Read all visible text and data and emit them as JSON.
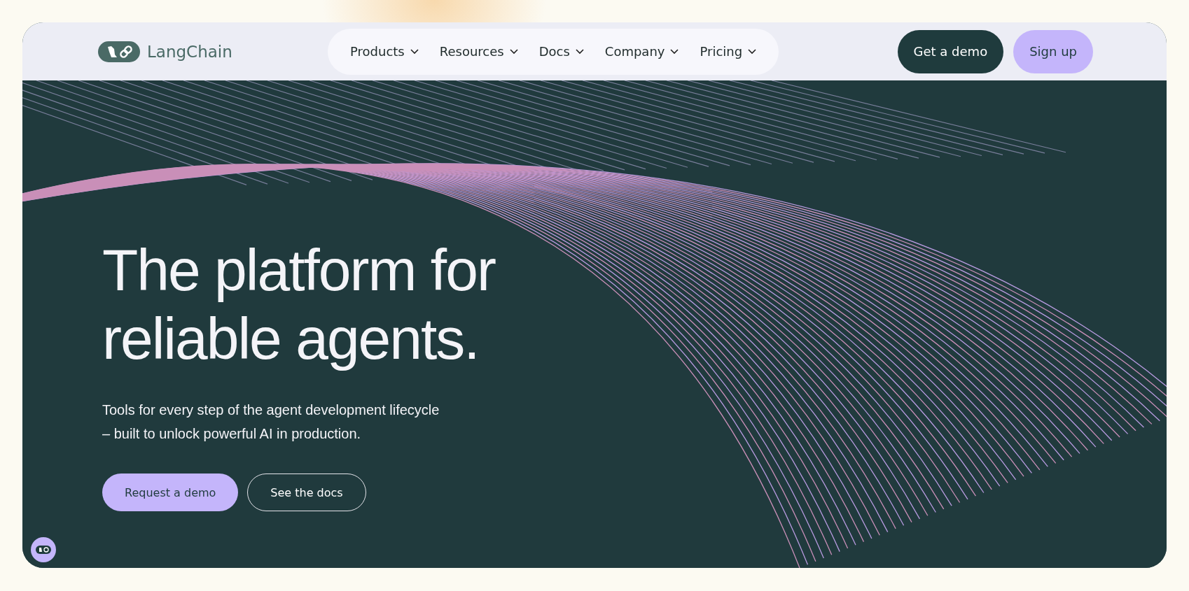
{
  "brand": {
    "name": "LangChain"
  },
  "nav": [
    {
      "label": "Products"
    },
    {
      "label": "Resources"
    },
    {
      "label": "Docs"
    },
    {
      "label": "Company"
    },
    {
      "label": "Pricing"
    }
  ],
  "header_buttons": [
    {
      "label": "Get a demo",
      "kind": "dark"
    },
    {
      "label": "Sign up",
      "kind": "light"
    }
  ],
  "hero": {
    "headline": [
      "The platform for",
      "reliable agents."
    ],
    "subtitle": [
      "Tools for every step of the agent development lifecycle",
      "– built to unlock powerful AI in production."
    ],
    "buttons": [
      {
        "label": "Request a demo",
        "kind": "filled"
      },
      {
        "label": "See the docs",
        "kind": "outline"
      }
    ]
  }
}
